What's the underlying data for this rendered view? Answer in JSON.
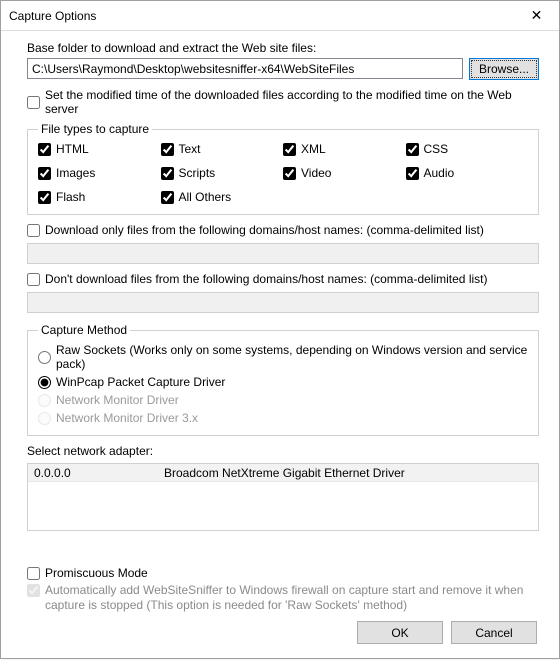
{
  "title": "Capture Options",
  "close_glyph": "✕",
  "base_folder_label": "Base folder to download and extract the Web site files:",
  "base_folder_value": "C:\\Users\\Raymond\\Desktop\\websitesniffer-x64\\WebSiteFiles",
  "browse_label": "Browse...",
  "modified_time_label": "Set the modified time of the downloaded files according to the modified time on the Web server",
  "file_types": {
    "legend": "File types to capture",
    "items": [
      {
        "label": "HTML"
      },
      {
        "label": "Text"
      },
      {
        "label": "XML"
      },
      {
        "label": "CSS"
      },
      {
        "label": "Images"
      },
      {
        "label": "Scripts"
      },
      {
        "label": "Video"
      },
      {
        "label": "Audio"
      },
      {
        "label": "Flash"
      },
      {
        "label": "All Others"
      }
    ]
  },
  "download_only_label": "Download only files from the following domains/host names: (comma-delimited list)",
  "dont_download_label": "Don't download files from the following domains/host names: (comma-delimited list)",
  "capture_method": {
    "legend": "Capture Method",
    "raw": "Raw Sockets  (Works only on some systems, depending on Windows version and service pack)",
    "winpcap": "WinPcap Packet Capture Driver",
    "netmon": "Network Monitor Driver",
    "netmon3x": "Network Monitor Driver 3.x"
  },
  "adapter_label": "Select network adapter:",
  "adapter": {
    "ip": "0.0.0.0",
    "name": "Broadcom NetXtreme Gigabit Ethernet Driver"
  },
  "promiscuous_label": "Promiscuous Mode",
  "auto_firewall_label": "Automatically add WebSiteSniffer to Windows firewall on capture start and remove it when capture is stopped (This option is needed for 'Raw Sockets' method)",
  "buttons": {
    "ok": "OK",
    "cancel": "Cancel"
  }
}
